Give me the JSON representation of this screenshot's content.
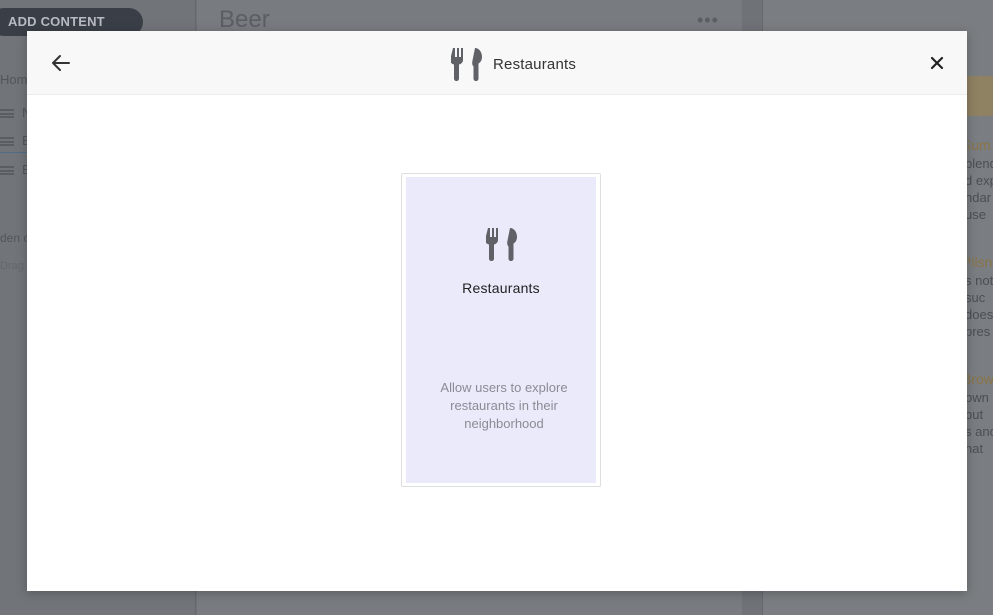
{
  "background": {
    "add_content_label": "ADD CONTENT",
    "page_title": "Beer",
    "more_label": "•••",
    "sidebar_fragments": [
      "Hom",
      "N",
      "B",
      "B",
      "den c",
      "Drag"
    ],
    "right_headings": [
      "Sum",
      "Pilsn",
      "Brow"
    ],
    "right_text": [
      "blend",
      "d exp",
      "ndar",
      "use",
      "s not",
      "suc",
      "does",
      "pres",
      "own",
      "but",
      "s and",
      "hat"
    ]
  },
  "modal": {
    "header": {
      "back_icon": "arrow-left-icon",
      "title": "Restaurants",
      "title_icon": "fork-knife-icon",
      "close_icon": "close-icon"
    },
    "card": {
      "icon": "fork-knife-icon",
      "title": "Restaurants",
      "description": "Allow users to explore restaurants in their neighborhood",
      "accent_color": "#eaeafb"
    }
  },
  "colors": {
    "overlay": "#6f7378",
    "icon": "#5f6167",
    "card_bg": "#eaeafb"
  }
}
